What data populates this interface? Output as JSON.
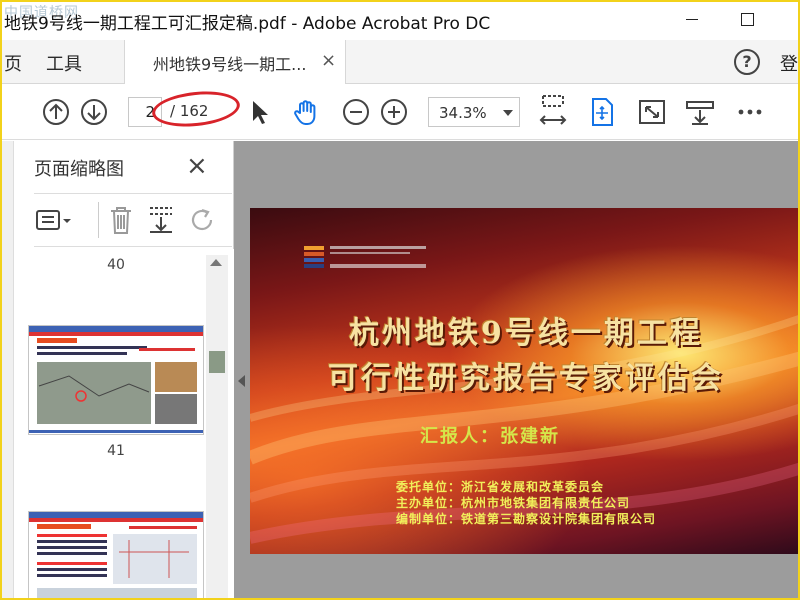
{
  "window": {
    "title": "地铁9号线一期工程工可汇报定稿.pdf - Adobe Acrobat Pro DC",
    "watermark": "中国道桥网"
  },
  "menubar": {
    "home_label": "页",
    "tools_label": "工具",
    "tab_label": "州地铁9号线一期工...",
    "tab_close": "×",
    "help": "?",
    "login_label": "登"
  },
  "toolbar": {
    "current_page": "2",
    "total_pages": "/ 162",
    "zoom": "34.3%"
  },
  "panel": {
    "title": "页面缩略图",
    "close": "×",
    "thumbnails": [
      {
        "page": "40"
      },
      {
        "page": "41"
      }
    ]
  },
  "slide": {
    "title_line1": "杭州地铁9号线一期工程",
    "title_line2": "可行性研究报告专家评估会",
    "reporter": "汇报人：张建新",
    "orgs": [
      "委托单位：浙江省发展和改革委员会",
      "主办单位：杭州市地铁集团有限责任公司",
      "编制单位：铁道第三勘察设计院集团有限公司"
    ]
  },
  "colors": {
    "annotation_red": "#d8232a",
    "hand_tool_blue": "#1473e6",
    "frame_yellow": "#f2d21b"
  }
}
